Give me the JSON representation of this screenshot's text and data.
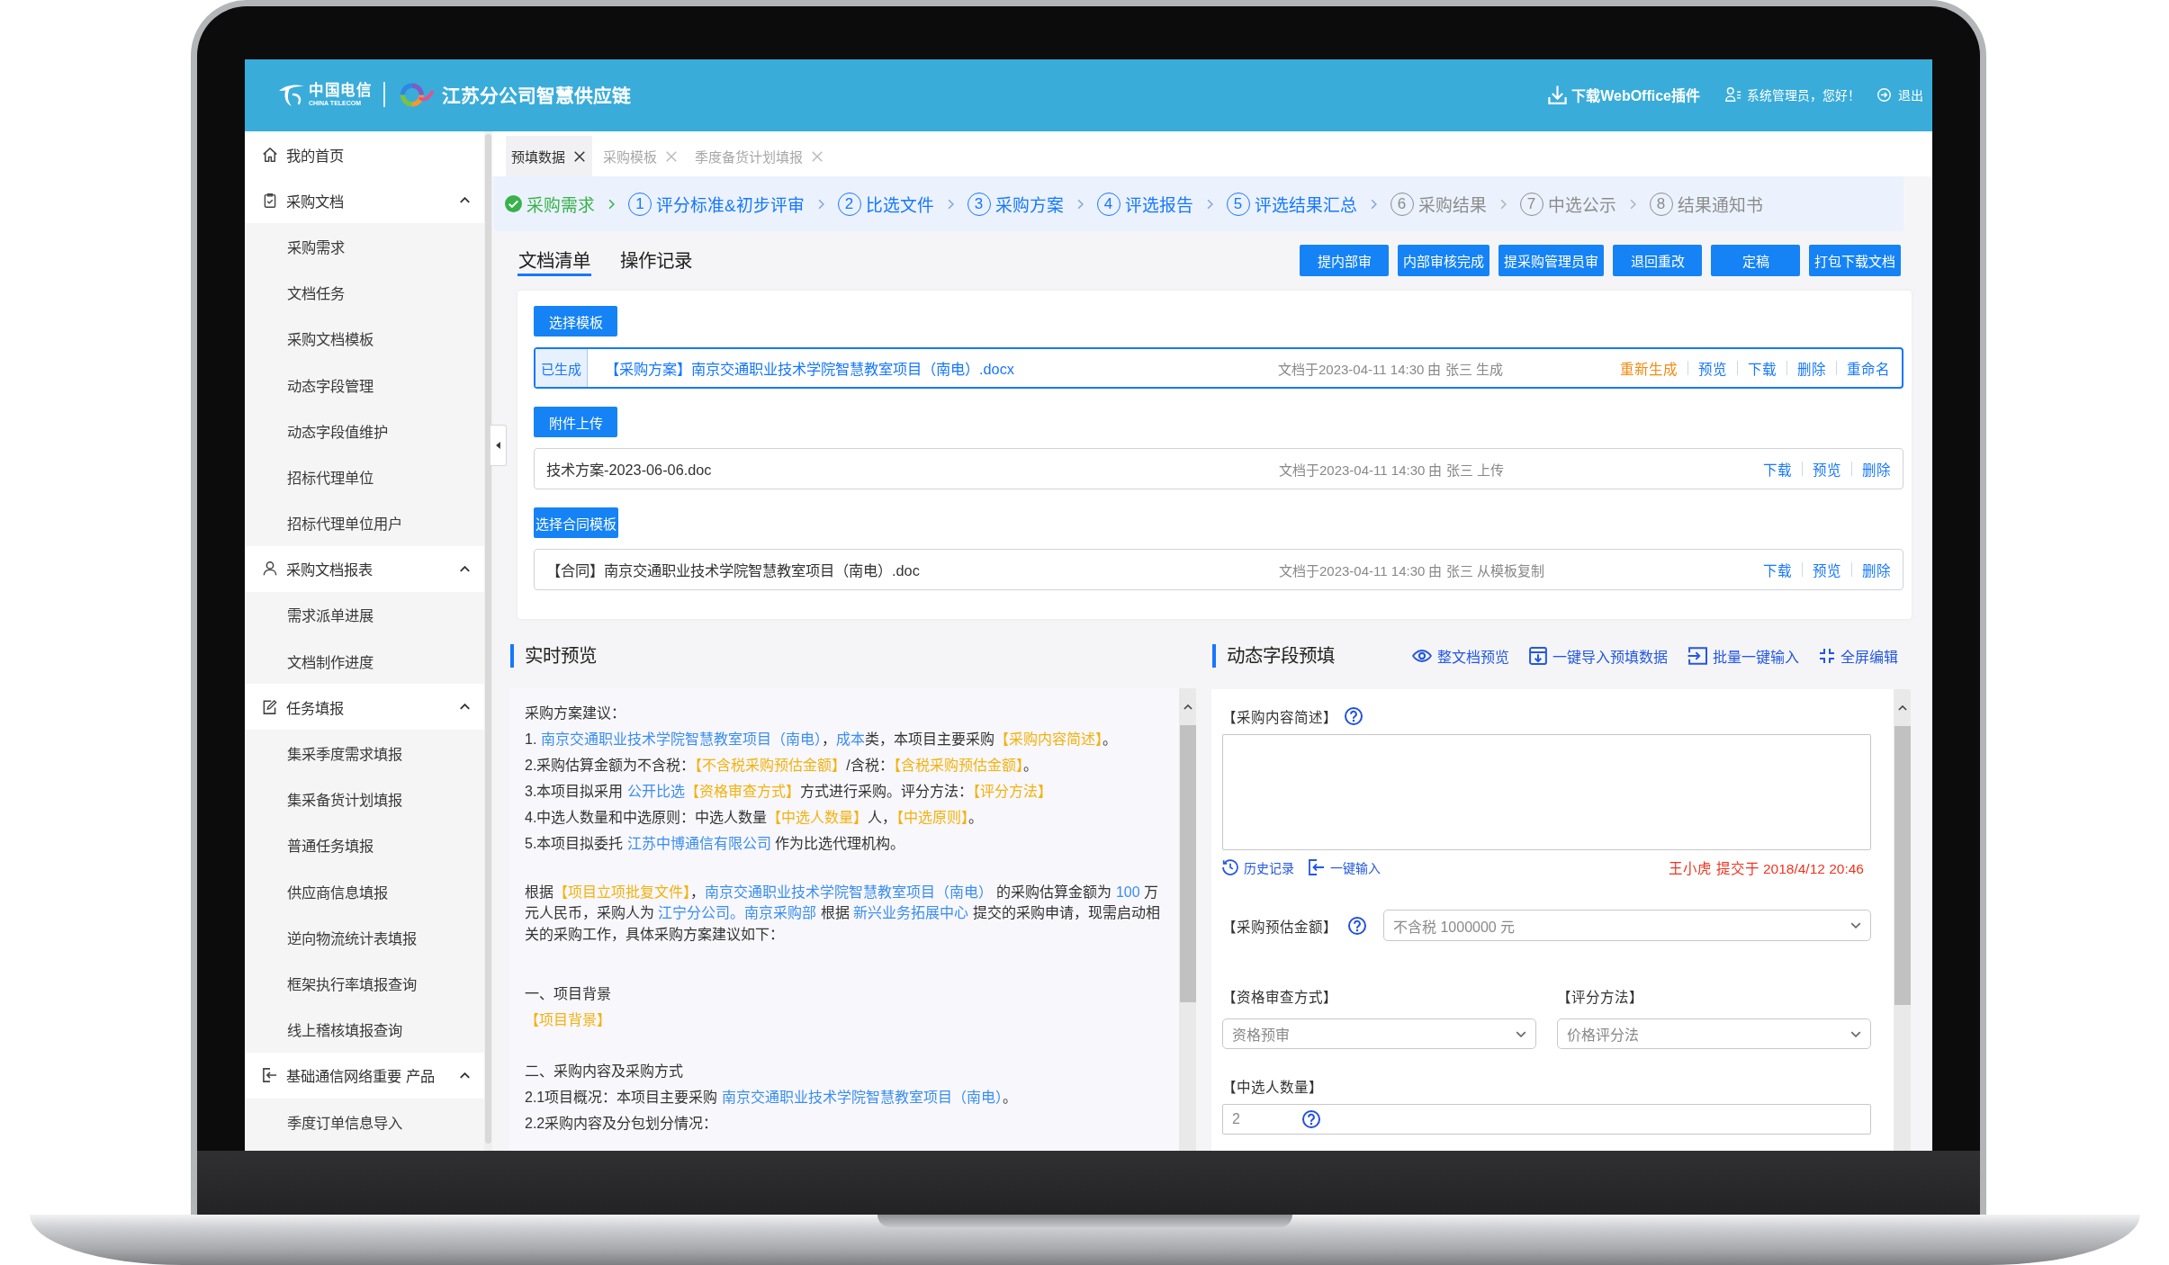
{
  "header": {
    "logo_text": "中国电信",
    "logo_subtext": "CHINA TELECOM",
    "title": "江苏分公司智慧供应链",
    "links": [
      {
        "kind": "download",
        "label": "下载WebOffice插件"
      },
      {
        "kind": "user",
        "label": "系统管理员，您好！"
      },
      {
        "kind": "logout",
        "label": "退出"
      }
    ]
  },
  "sidebar": {
    "items": [
      {
        "label": "我的首页",
        "kind": "home"
      },
      {
        "label": "采购文档",
        "kind": "document",
        "expanded": true,
        "children": [
          {
            "label": "采购需求"
          },
          {
            "label": "文档任务"
          },
          {
            "label": "采购文档模板"
          },
          {
            "label": "动态字段管理"
          },
          {
            "label": "动态字段值维护"
          },
          {
            "label": "招标代理单位"
          },
          {
            "label": "招标代理单位用户"
          }
        ]
      },
      {
        "label": "采购文档报表",
        "kind": "person",
        "expanded": true,
        "children": [
          {
            "label": "需求派单进展"
          },
          {
            "label": "文档制作进度"
          }
        ]
      },
      {
        "label": "任务填报",
        "kind": "edit",
        "expanded": true,
        "children": [
          {
            "label": "集采季度需求填报"
          },
          {
            "label": "集采备货计划填报"
          },
          {
            "label": "普通任务填报"
          },
          {
            "label": "供应商信息填报"
          },
          {
            "label": "逆向物流统计表填报"
          },
          {
            "label": "框架执行率填报查询"
          },
          {
            "label": "线上稽核填报查询"
          }
        ]
      },
      {
        "label": "基础通信网络重要 产品",
        "kind": "import",
        "expanded": true,
        "children": [
          {
            "label": "季度订单信息导入"
          }
        ]
      }
    ]
  },
  "tabs": [
    {
      "label": "预填数据",
      "selected": true
    },
    {
      "label": "采购模板",
      "selected": false
    },
    {
      "label": "季度备货计划填报",
      "selected": false
    }
  ],
  "steps": [
    {
      "label": "采购需求",
      "done": true,
      "disabled": false
    },
    {
      "number": "1",
      "label": "评分标准&初步评审",
      "done": false,
      "disabled": false
    },
    {
      "number": "2",
      "label": "比选文件",
      "done": false,
      "disabled": false
    },
    {
      "number": "3",
      "label": "采购方案",
      "done": false,
      "disabled": false
    },
    {
      "number": "4",
      "label": "评选报告",
      "done": false,
      "disabled": false
    },
    {
      "number": "5",
      "label": "评选结果汇总",
      "done": false,
      "disabled": false
    },
    {
      "number": "6",
      "label": "采购结果",
      "done": false,
      "disabled": true
    },
    {
      "number": "7",
      "label": "中选公示",
      "done": false,
      "disabled": true
    },
    {
      "number": "8",
      "label": "结果通知书",
      "done": false,
      "disabled": true
    }
  ],
  "doc_tabs": [
    {
      "label": "文档清单",
      "selected": true
    },
    {
      "label": "操作记录",
      "selected": false
    }
  ],
  "actions": [
    "提内部审",
    "内部审核完成",
    "提采购管理员审",
    "退回重改",
    "定稿",
    "打包下载文档"
  ],
  "documents": [
    {
      "button": "选择模板",
      "files": [
        {
          "tag": "已生成",
          "selected": true,
          "name": "【采购方案】南京交通职业技术学院智慧教室项目（南电）.docx",
          "info": "文档于2023-04-11 14:30 由 张三 生成",
          "actions": [
            {
              "label": "重新生成",
              "kind": "warning"
            },
            {
              "label": "预览",
              "kind": "link"
            },
            {
              "label": "下载",
              "kind": "link"
            },
            {
              "label": "删除",
              "kind": "link"
            },
            {
              "label": "重命名",
              "kind": "link"
            }
          ]
        }
      ]
    },
    {
      "button": "附件上传",
      "files": [
        {
          "selected": false,
          "name": "技术方案-2023-06-06.doc",
          "info": "文档于2023-04-11 14:30 由 张三 上传",
          "actions": [
            {
              "label": "下载",
              "kind": "link"
            },
            {
              "label": "预览",
              "kind": "link"
            },
            {
              "label": "删除",
              "kind": "link"
            }
          ]
        }
      ]
    },
    {
      "button": "选择合同模板",
      "files": [
        {
          "selected": false,
          "name": "【合同】南京交通职业技术学院智慧教室项目（南电）.doc",
          "info": "文档于2023-04-11 14:30 由 张三 从模板复制",
          "actions": [
            {
              "label": "下载",
              "kind": "link"
            },
            {
              "label": "预览",
              "kind": "link"
            },
            {
              "label": "删除",
              "kind": "link"
            }
          ]
        }
      ]
    }
  ],
  "preview": {
    "title": "实时预览",
    "sections": [
      {
        "kind": "list",
        "lines": [
          [
            {
              "kind": "text",
              "text": "采购方案建议："
            }
          ],
          [
            {
              "kind": "text",
              "text": "1. "
            },
            {
              "kind": "value",
              "text": "南京交通职业技术学院智慧教室项目（南电）"
            },
            {
              "kind": "text",
              "text": "，"
            },
            {
              "kind": "value",
              "text": "成本"
            },
            {
              "kind": "text",
              "text": "类，本项目主要采购"
            },
            {
              "kind": "field",
              "text": "【采购内容简述】"
            },
            {
              "kind": "text",
              "text": "。"
            }
          ],
          [
            {
              "kind": "text",
              "text": "2.采购估算金额为不含税："
            },
            {
              "kind": "field",
              "text": "【不含税采购预估金额】"
            },
            {
              "kind": "text",
              "text": "/含税："
            },
            {
              "kind": "field",
              "text": "【含税采购预估金额】"
            },
            {
              "kind": "text",
              "text": "。"
            }
          ],
          [
            {
              "kind": "text",
              "text": "3.本项目拟采用 "
            },
            {
              "kind": "value",
              "text": "公开比选"
            },
            {
              "kind": "field",
              "text": "【资格审查方式】"
            },
            {
              "kind": "text",
              "text": "方式进行采购。评分方法："
            },
            {
              "kind": "field",
              "text": "【评分方法】"
            }
          ],
          [
            {
              "kind": "text",
              "text": "4.中选人数量和中选原则：中选人数量"
            },
            {
              "kind": "field",
              "text": "【中选人数量】"
            },
            {
              "kind": "text",
              "text": "人，"
            },
            {
              "kind": "field",
              "text": "【中选原则】"
            },
            {
              "kind": "text",
              "text": "。"
            }
          ],
          [
            {
              "kind": "text",
              "text": "5.本项目拟委托 "
            },
            {
              "kind": "value",
              "text": "江苏中博通信有限公司"
            },
            {
              "kind": "text",
              "text": " 作为比选代理机构。"
            }
          ]
        ]
      },
      {
        "kind": "paragraph",
        "lines": [
          [
            {
              "kind": "text",
              "text": "根据"
            },
            {
              "kind": "field",
              "text": "【项目立项批复文件】"
            },
            {
              "kind": "text",
              "text": "，"
            },
            {
              "kind": "value",
              "text": "南京交通职业技术学院智慧教室项目（南电）"
            },
            {
              "kind": "text",
              "text": " 的采购估算金额为 "
            },
            {
              "kind": "value",
              "text": "100"
            },
            {
              "kind": "text",
              "text": " 万元人民币，采购人为 "
            },
            {
              "kind": "value",
              "text": "江宁分公司。南京采购部"
            },
            {
              "kind": "text",
              "text": " 根据 "
            },
            {
              "kind": "value",
              "text": "新兴业务拓展中心"
            },
            {
              "kind": "text",
              "text": " 提交的采购申请，现需启动相关的采购工作，具体采购方案建议如下："
            }
          ]
        ]
      },
      {
        "kind": "list",
        "lines": [
          [
            {
              "kind": "text",
              "text": "一、项目背景"
            }
          ],
          [
            {
              "kind": "field",
              "text": "【项目背景】"
            }
          ]
        ]
      },
      {
        "kind": "list",
        "lines": [
          [
            {
              "kind": "text",
              "text": "二、采购内容及采购方式"
            }
          ],
          [
            {
              "kind": "text",
              "text": "2.1项目概况：本项目主要采购 "
            },
            {
              "kind": "value",
              "text": "南京交通职业技术学院智慧教室项目（南电）"
            },
            {
              "kind": "text",
              "text": "。"
            }
          ],
          [
            {
              "kind": "text",
              "text": "2.2采购内容及分包划分情况："
            }
          ]
        ]
      }
    ]
  },
  "form": {
    "title": "动态字段预填",
    "tools": [
      {
        "kind": "eye",
        "label": "整文档预览"
      },
      {
        "kind": "import",
        "label": "一键导入预填数据"
      },
      {
        "kind": "batch",
        "label": "批量一键输入"
      },
      {
        "kind": "fullscreen",
        "label": "全屏编辑"
      }
    ],
    "fields": [
      {
        "kind": "textarea",
        "label": "【采购内容简述】",
        "help": true,
        "links": [
          {
            "kind": "history",
            "label": "历史记录"
          },
          {
            "kind": "fill",
            "label": "一键输入"
          }
        ],
        "note": "王小虎 提交于 2018/4/12 20:46"
      },
      {
        "kind": "inline-select",
        "label": "【采购预估金额】",
        "help": true,
        "value": "不含税 1000000 元"
      },
      {
        "kind": "select",
        "label": "【资格审查方式】",
        "help": false,
        "value": "资格预审"
      },
      {
        "kind": "select",
        "label": "【评分方法】",
        "help": false,
        "value": "价格评分法"
      },
      {
        "kind": "input",
        "label": "【中选人数量】",
        "help": true,
        "value": "2"
      }
    ]
  }
}
